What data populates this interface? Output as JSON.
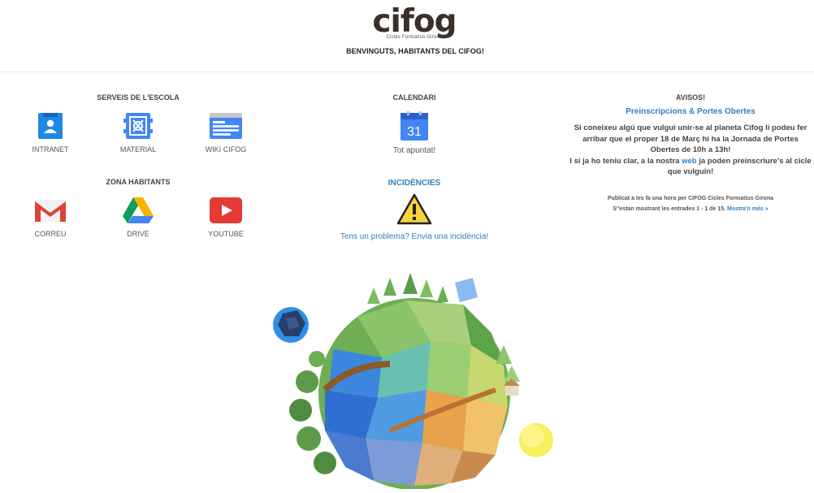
{
  "header": {
    "logo_text": "cifog",
    "logo_subtitle": "Cicles Formatius Girona",
    "welcome": "BENVINGUTS, HABITANTS DEL CIFOG!"
  },
  "serveis": {
    "title": "SERVEIS DE L'ESCOLA",
    "items": [
      {
        "label": "INTRANET",
        "icon": "intranet-icon"
      },
      {
        "label": "MATERIAL",
        "icon": "material-icon"
      },
      {
        "label": "WIKI CIFOG",
        "icon": "wiki-icon"
      }
    ]
  },
  "zona": {
    "title": "ZONA HABITANTS",
    "items": [
      {
        "label": "CORREU",
        "icon": "gmail-icon"
      },
      {
        "label": "DRIVE",
        "icon": "drive-icon"
      },
      {
        "label": "YOUTUBE",
        "icon": "youtube-icon"
      }
    ]
  },
  "calendari": {
    "title": "CALENDARI",
    "day": "31",
    "text": "Tot apuntat!"
  },
  "incidencies": {
    "title": "INCIDÈNCIES",
    "link": "Tens un problema? Envia una incidència!"
  },
  "avisos": {
    "title": "AVISOS!",
    "subtitle": "Preinscripcions & Portes Obertes",
    "body_1": "Si coneixeu algú que vulgui unir-se al planeta Cifog li podeu fer arribar que el proper 18 de Març hi ha la Jornada de Portes Obertes de 10h a 13h!",
    "body_2_pre": "I si ja ho teniu clar, a la nostra ",
    "body_2_link": "web",
    "body_2_post": " ja poden preinscriure's al cicle que vulguin!",
    "meta_1": "Publicat a les fa una hora per CIFOG Cicles Formatius Girona",
    "meta_2": "S''estan mostrant les entrades 1 - 1 de 15.",
    "meta_more": "Mostra'n més »"
  },
  "colors": {
    "accent": "#2f7fc1",
    "intranet_blue": "#1e88e5",
    "material_blue": "#4285f4",
    "youtube_red": "#e53935",
    "gmail_red": "#db4437",
    "warning_yellow": "#f9d23c"
  }
}
